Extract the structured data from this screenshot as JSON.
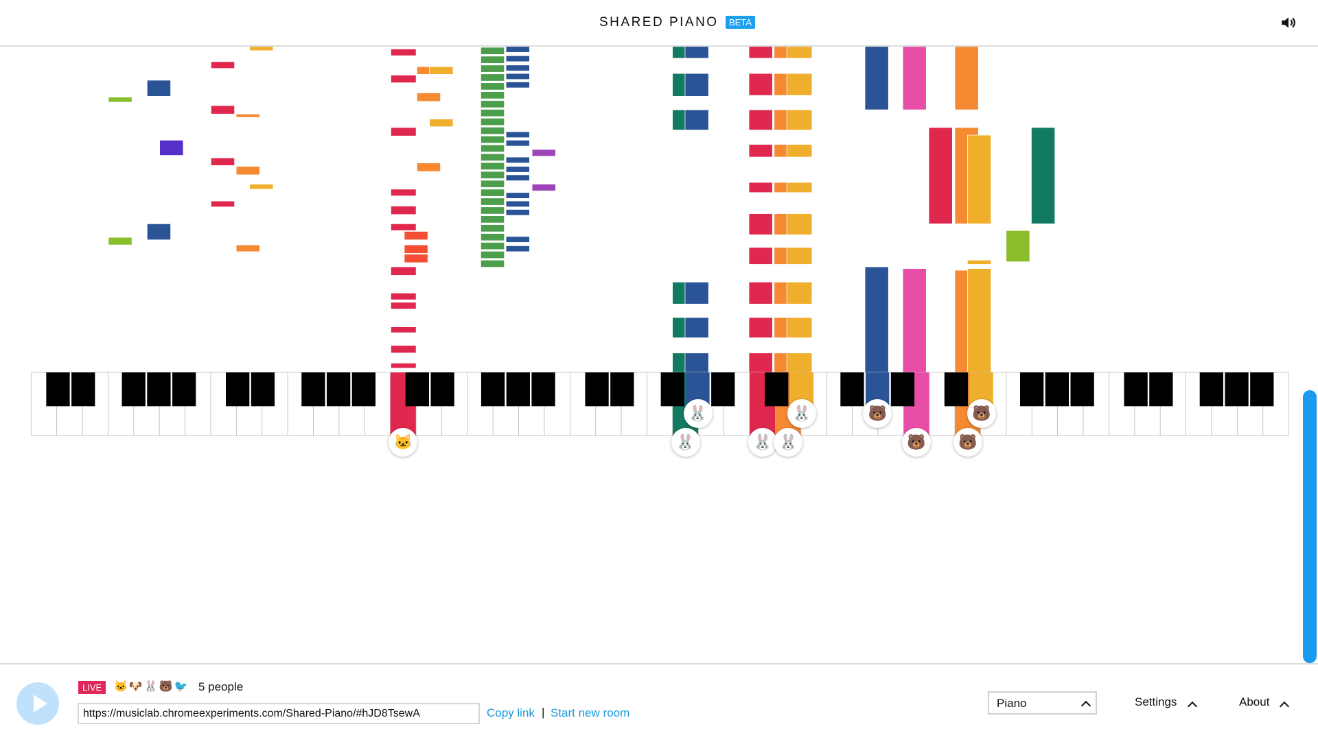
{
  "header": {
    "title": "SHARED PIANO",
    "badge": "BETA",
    "sound_icon": "speaker-icon"
  },
  "colors": {
    "accent": "#1a9af0",
    "live": "#e0285a",
    "play": "#bfe1fb"
  },
  "keyboard": {
    "first_key": "C1",
    "last_key": "B7",
    "white_keys": 49,
    "active_keys": [
      {
        "note": "C3",
        "color": "#e0284f",
        "user": "🐱"
      },
      {
        "note": "G4",
        "color": "#127a60",
        "user": "🐰"
      },
      {
        "note": "G#4",
        "color": "#2b5497",
        "user": "🐰"
      },
      {
        "note": "C5",
        "color": "#e0284f",
        "user": "🐰"
      },
      {
        "note": "D5",
        "color": "#f58a33",
        "user": "🐰"
      },
      {
        "note": "D#5",
        "color": "#f0ae2d",
        "user": "🐰"
      },
      {
        "note": "G#5",
        "color": "#2b5497",
        "user": "🐻"
      },
      {
        "note": "B5",
        "color": "#e84ea8",
        "user": "🐻"
      },
      {
        "note": "D6",
        "color": "#f58a33",
        "user": "🐻"
      },
      {
        "note": "D#6",
        "color": "#f0ae2d",
        "user": "🐻"
      }
    ]
  },
  "footer": {
    "live_label": "LIVE",
    "users": "🐱🐶🐰🐻🐦",
    "people_count": "5 people",
    "room_url": "https://musiclab.chromeexperiments.com/Shared-Piano/#hJD8TsewA",
    "copy_link": "Copy link",
    "separator": "|",
    "new_room": "Start new room",
    "instrument": "Piano",
    "settings": "Settings",
    "about": "About"
  }
}
